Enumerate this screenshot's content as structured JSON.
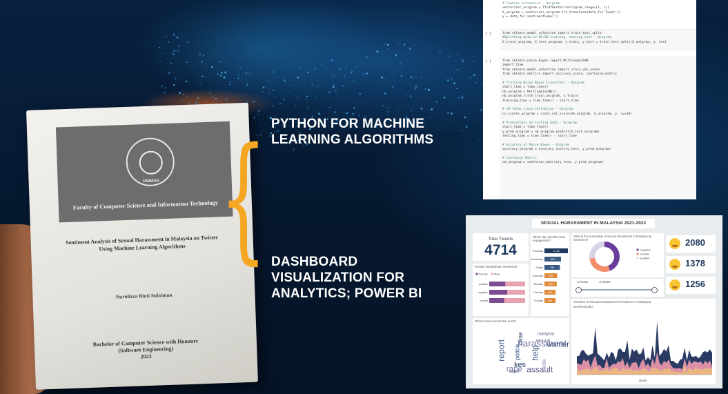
{
  "headings": {
    "python_line1": "PYTHON FOR MACHINE",
    "python_line2": "LEARNING ALGORITHMS",
    "dashboard_line1": "DASHBOARD",
    "dashboard_line2": "VISUALIZATION FOR",
    "dashboard_line3": "ANALYTICS; POWER BI"
  },
  "thesis": {
    "seal_text": "UNIVERSITI MALAYSIA SARAWAK",
    "seal_bottom": "UNIMAS",
    "faculty": "Faculty of Computer Science and Information Technology",
    "title_line1": "Sentiment Analysis of Sexual Harassment in Malaysia on Twitter",
    "title_line2": "Using Machine Learning Algorithms",
    "author": "Nurulizza Binti Sulaiman",
    "degree_line1": "Bachelor of Computer Science with Honours",
    "degree_line2": "(Software Engineering)",
    "degree_line3": "2023"
  },
  "code": {
    "cell0": [
      "# Feature Extraction - Unigram",
      "vectorizer_unigram = TfidfVectorizer(ngram_range=(1, 1))",
      "X_unigram = vectorizer_unigram.fit_transform(data_fe['Tweet'])",
      "y = data_fe['sentimentLabel']"
    ],
    "cell1": [
      "from sklearn.model_selection import train_test_split",
      "#Splitting data to 80:20 training, testing sets - Unigram",
      "X_train_unigram, X_test_unigram, y_train, y_test = train_test_split(X_unigram, y, test"
    ],
    "cell2": [
      "from sklearn.naive_bayes import MultinomialNB",
      "import time",
      "from sklearn.model_selection import cross_val_score",
      "from sklearn.metrics import accuracy_score, confusion_matrix",
      "",
      "# Training Naive Bayes Classifier - Unigram",
      "start_time = time.time()",
      "nb_unigram = MultinomialNB()",
      "nb_unigram.fit(X_train_unigram, y_train)",
      "training_time = time.time() - start_time",
      "",
      "# 10-folds cross-validation - Unigram",
      "cv_scores_unigram = cross_val_score(nb_unigram, X_unigram, y, cv=10)",
      "",
      "# Predictions on testing data - Unigram",
      "start_time = time.time()",
      "y_pred_unigram = nb_unigram.predict(X_test_unigram)",
      "testing_time = time.time() - start_time",
      "",
      "# Accuracy of Naive Bayes - Unigram",
      "accuracy_unigram = accuracy_score(y_test, y_pred_unigram)",
      "",
      "# Confusion Matrix",
      "cm_unigram = confusion_matrix(y_test, y_pred_unigram)"
    ],
    "prompt": "[ ]"
  },
  "dashboard": {
    "title": "SEXUAL HARASSMENT IN MALAYSIA 2021-2023",
    "total_tweets_label": "Total Tweets",
    "total_tweets_value": "4714",
    "day_question": "Which day has the most engagement?",
    "days": [
      "Thursday",
      "Wednesday",
      "Friday",
      "Saturday",
      "Monday",
      "Tuesday",
      "Sunday"
    ],
    "day_values": [
      1148,
      809,
      759,
      620,
      604,
      545,
      540
    ],
    "day_value_labels": [
      "1,148",
      "809",
      "759",
      "620",
      "604",
      "545",
      "540"
    ],
    "donut_question": "What is the percentage of Sexual Harassment in Malaysia by Sentiment?",
    "sentiment_legend": [
      "negative",
      "neutral",
      "positive"
    ],
    "sentiment_colors": [
      "#6a3d9a",
      "#f28e6b",
      "#d9d2e9"
    ],
    "gender_title": "Gender Breakdown Sentiment",
    "gender_legend": [
      "Female",
      "Male"
    ],
    "gender_rows": [
      "positive",
      "negative",
      "neutral"
    ],
    "emoji_counts": [
      "2080",
      "1378",
      "1256"
    ],
    "date_start": "1/1/2021",
    "date_end": "1/1/2023",
    "timeline_title": "Timeline of Sexual Harassment Prevalence in Malaysia",
    "timeline_legend_label": "sentimentLabel",
    "timeline_legend": [
      "negative",
      "neutral",
      "positive"
    ],
    "timeline_axis": "Month",
    "word_question": "Which word occurs the most?",
    "words": [
      "women",
      "sexual",
      "report",
      "harassment",
      "case",
      "malaysia",
      "police",
      "rape",
      "victim",
      "assault",
      "help",
      "ada",
      "kes"
    ]
  }
}
